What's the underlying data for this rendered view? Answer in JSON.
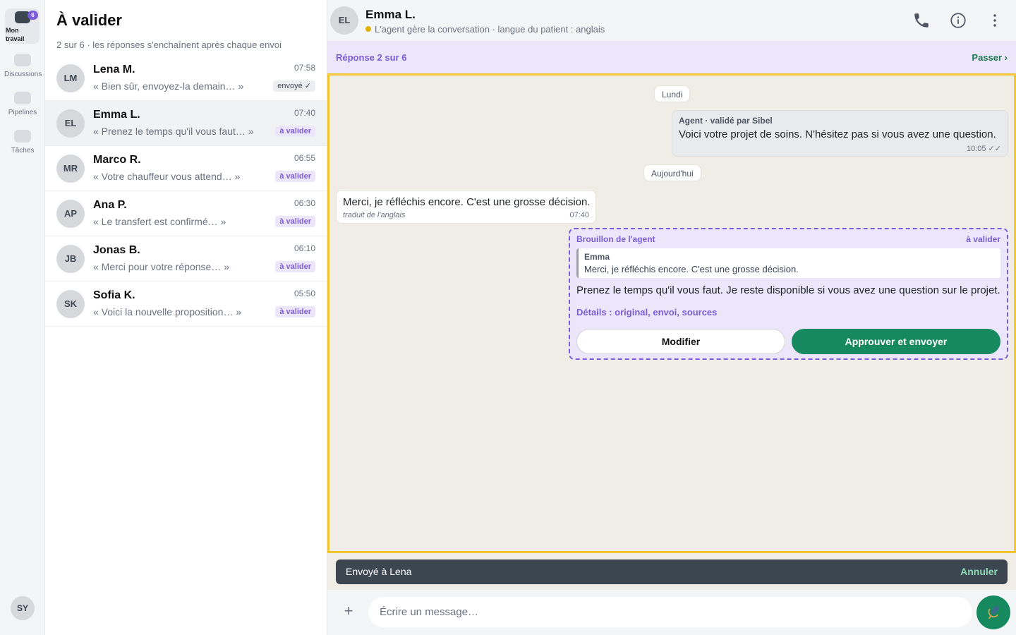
{
  "rail": {
    "items": [
      {
        "label": "Mon travail",
        "badge": "6"
      },
      {
        "label": "Discussions"
      },
      {
        "label": "Pipelines"
      },
      {
        "label": "Tâches"
      }
    ],
    "self_initials": "SY"
  },
  "list": {
    "title": "À valider",
    "subtitle": "2 sur 6 · les réponses s'enchaînent après chaque envoi",
    "conversations": [
      {
        "initials": "LM",
        "name": "Lena M.",
        "time": "07:58",
        "preview": "« Bien sûr, envoyez-la demain… »",
        "status": "envoyé ✓"
      },
      {
        "initials": "EL",
        "name": "Emma L.",
        "time": "07:40",
        "preview": "« Prenez le temps qu'il vous faut… »",
        "status": "à valider"
      },
      {
        "initials": "MR",
        "name": "Marco R.",
        "time": "06:55",
        "preview": "« Votre chauffeur vous attend… »",
        "status": "à valider"
      },
      {
        "initials": "AP",
        "name": "Ana P.",
        "time": "06:30",
        "preview": "« Le transfert est confirmé… »",
        "status": "à valider"
      },
      {
        "initials": "JB",
        "name": "Jonas B.",
        "time": "06:10",
        "preview": "« Merci pour votre réponse… »",
        "status": "à valider"
      },
      {
        "initials": "SK",
        "name": "Sofia K.",
        "time": "05:50",
        "preview": "« Voici la nouvelle proposition… »",
        "status": "à valider"
      }
    ]
  },
  "chat": {
    "header": {
      "initials": "EL",
      "name": "Emma L.",
      "status": "L'agent gère la conversation · langue du patient : anglais"
    },
    "progress": {
      "text": "Réponse 2 sur 6",
      "skip": "Passer ›"
    },
    "thread": {
      "day1": "Lundi",
      "outgoing": {
        "meta": "Agent · validé par Sibel",
        "text": "Voici votre projet de soins. N'hésitez pas si vous avez une question.",
        "time": "10:05 ✓✓"
      },
      "day2": "Aujourd'hui",
      "incoming": {
        "text": "Merci, je réfléchis encore. C'est une grosse décision.",
        "note": "traduit de l'anglais",
        "time": "07:40"
      },
      "draft": {
        "label": "Brouillon de l'agent",
        "status": "à valider",
        "quote_name": "Emma",
        "quote_text": "Merci, je réfléchis encore. C'est une grosse décision.",
        "text": "Prenez le temps qu'il vous faut. Je reste disponible si vous avez une question sur le projet.",
        "details": "Détails : original, envoi, sources",
        "edit_label": "Modifier",
        "approve_label": "Approuver et envoyer"
      }
    },
    "toast": {
      "text": "Envoyé à Lena",
      "undo": "Annuler"
    },
    "composer": {
      "placeholder": "Écrire un message…",
      "plus": "+"
    }
  },
  "colors": {
    "accent": "#7c5cd6",
    "primary": "#168a5e",
    "focus_outline": "#f3c531",
    "status_dot": "#e0b400"
  },
  "icons": [
    "phone-icon",
    "info-icon",
    "more-vertical-icon",
    "plus-icon",
    "microphone-icon",
    "double-check-icon"
  ]
}
